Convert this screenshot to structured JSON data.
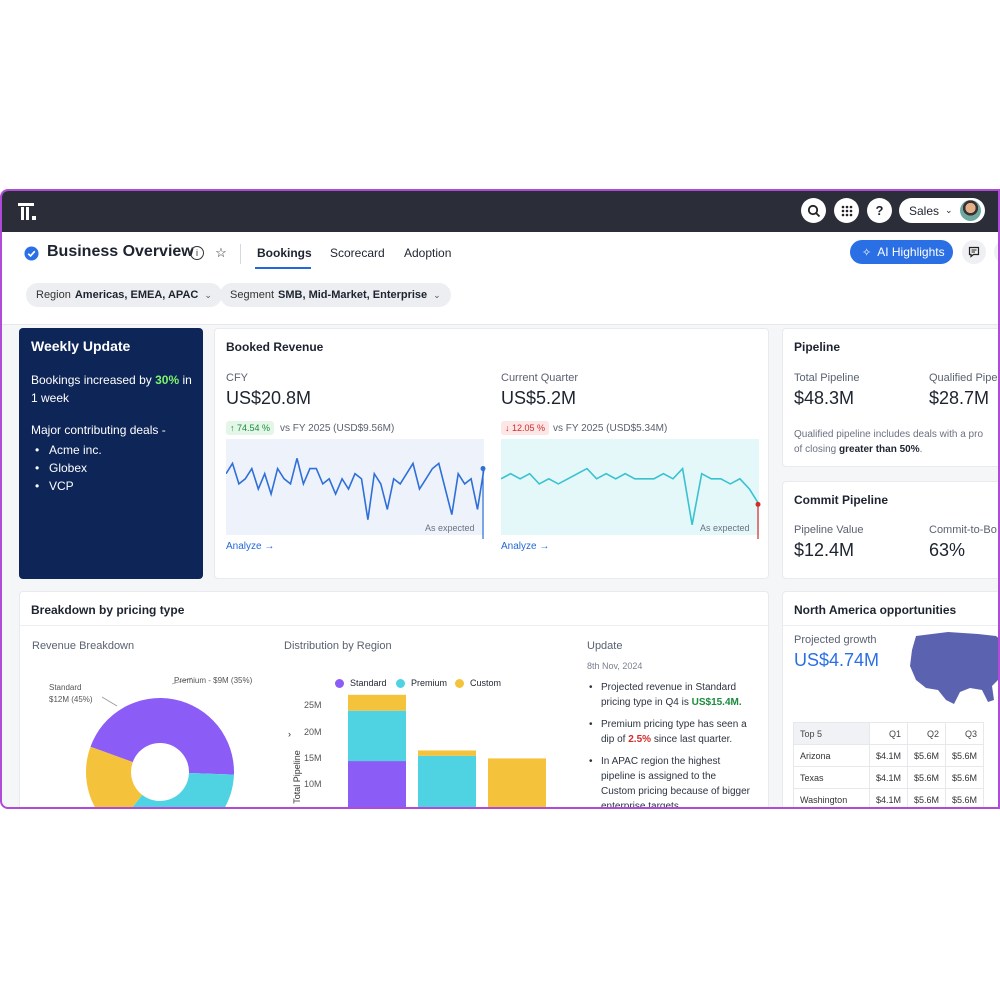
{
  "topbar": {
    "icons": [
      "app-logo",
      "search-icon",
      "apps-grid-icon",
      "help-icon"
    ],
    "sales_label": "Sales"
  },
  "header": {
    "title": "Business Overview",
    "tabs": [
      {
        "label": "Bookings",
        "active": true
      },
      {
        "label": "Scorecard",
        "active": false
      },
      {
        "label": "Adoption",
        "active": false
      }
    ],
    "ai_button": "AI Highlights",
    "filters": [
      {
        "label": "Region",
        "value": "Americas, EMEA, APAC"
      },
      {
        "label": "Segment",
        "value": "SMB, Mid-Market, Enterprise"
      }
    ],
    "accent_color": "#2b6fe5"
  },
  "weekly": {
    "title": "Weekly Update",
    "line1_pre": "Bookings increased by",
    "line1_value": "30%",
    "line1_post": "in 1 week",
    "deals_heading": "Major contributing deals -",
    "deals": [
      "Acme inc.",
      "Globex",
      "VCP"
    ]
  },
  "booked_revenue": {
    "title": "Booked Revenue",
    "cfy": {
      "label": "CFY",
      "value": "US$20.8M",
      "change": "74.54 %",
      "vs": "vs FY 2025 (USD$9.56M)",
      "caption": "As expected",
      "analyze": "Analyze →"
    },
    "quarter": {
      "label": "Current Quarter",
      "value": "US$5.2M",
      "change": "12.05 %",
      "vs": "vs FY 2025 (USD$5.34M)",
      "caption": "As expected",
      "analyze": "Analyze →"
    }
  },
  "pipeline": {
    "title": "Pipeline",
    "total_label": "Total Pipeline",
    "total_value": "$48.3M",
    "qualified_label": "Qualified Pipel",
    "qualified_value": "$28.7M",
    "note_pre": "Qualified pipeline includes deals with a pro",
    "note_mid": "of closing",
    "note_bold": "greater than 50%",
    "note_post": "."
  },
  "commit": {
    "title": "Commit Pipeline",
    "value_label": "Pipeline Value",
    "value": "$12.4M",
    "ratio_label": "Commit-to-Bo",
    "ratio": "63%"
  },
  "breakdown": {
    "title": "Breakdown by pricing type",
    "revenue_heading": "Revenue Breakdown",
    "region_heading": "Distribution by Region",
    "update_heading": "Update",
    "update_date": "8th Nov, 2024",
    "pie_label_standard_1": "Standard",
    "pie_label_standard_2": "$12M (45%)",
    "pie_label_premium": "Premium - $9M (35%)",
    "legend": [
      "Standard",
      "Premium",
      "Custom"
    ],
    "y_axis_title": "Total Pipeline",
    "y_ticks": [
      "25M",
      "20M",
      "15M",
      "10M"
    ],
    "updates": {
      "u1_pre": "Projected revenue in Standard pricing type in Q4 is",
      "u1_value": "US$15.4M.",
      "u2_pre": "Premium pricing type has seen a dip of",
      "u2_value": "2.5%",
      "u2_post": "since last quarter.",
      "u3": "In APAC region the highest pipeline is assigned to the Custom pricing because of bigger enterprise targets."
    }
  },
  "nao": {
    "title": "North America opportunities",
    "growth_label": "Projected growth",
    "growth_value": "US$4.74M",
    "table_headers": [
      "Top 5",
      "Q1",
      "Q2",
      "Q3"
    ],
    "rows": [
      [
        "Arizona",
        "$4.1M",
        "$5.6M",
        "$5.6M"
      ],
      [
        "Texas",
        "$4.1M",
        "$5.6M",
        "$5.6M"
      ],
      [
        "Washington",
        "$4.1M",
        "$5.6M",
        "$5.6M"
      ]
    ]
  },
  "colors": {
    "standard": "#8b5cf6",
    "premium": "#4fd3e3",
    "custom": "#f5c33b",
    "navy": "#0e2558",
    "line_blue": "#2f6fd8",
    "line_teal": "#39c2d0"
  },
  "chart_data": [
    {
      "type": "pie",
      "title": "Revenue Breakdown",
      "categories": [
        "Standard",
        "Premium",
        "Custom"
      ],
      "values": [
        45,
        35,
        20
      ],
      "labels": [
        "$12M (45%)",
        "$9M (35%)",
        ""
      ]
    },
    {
      "type": "bar",
      "title": "Distribution by Region",
      "ylabel": "Total Pipeline",
      "ylim": [
        0,
        25
      ],
      "series": [
        {
          "name": "Standard",
          "values": [
            11.5,
            2,
            0
          ]
        },
        {
          "name": "Premium",
          "values": [
            9.5,
            10.5,
            0
          ]
        },
        {
          "name": "Custom",
          "values": [
            3,
            1,
            12
          ]
        }
      ],
      "stacked": true
    },
    {
      "type": "line",
      "title": "CFY",
      "values": [
        12,
        14,
        10,
        11,
        13,
        9,
        12,
        8,
        13,
        11,
        10,
        15,
        10,
        13,
        13,
        10,
        11,
        8,
        11,
        9,
        12,
        11,
        3,
        12,
        10,
        5,
        11,
        10,
        12,
        14,
        9,
        11,
        13,
        14,
        9,
        4,
        12,
        10,
        11,
        5,
        13
      ],
      "ylim": [
        0,
        18
      ]
    },
    {
      "type": "line",
      "title": "Current Quarter",
      "values": [
        11,
        12,
        11,
        12,
        10,
        11,
        10,
        11,
        12,
        13,
        11,
        12,
        11,
        12,
        11,
        11,
        11,
        12,
        11,
        13,
        2,
        12,
        11,
        11,
        10,
        11,
        9,
        6
      ],
      "ylim": [
        0,
        18
      ]
    }
  ]
}
